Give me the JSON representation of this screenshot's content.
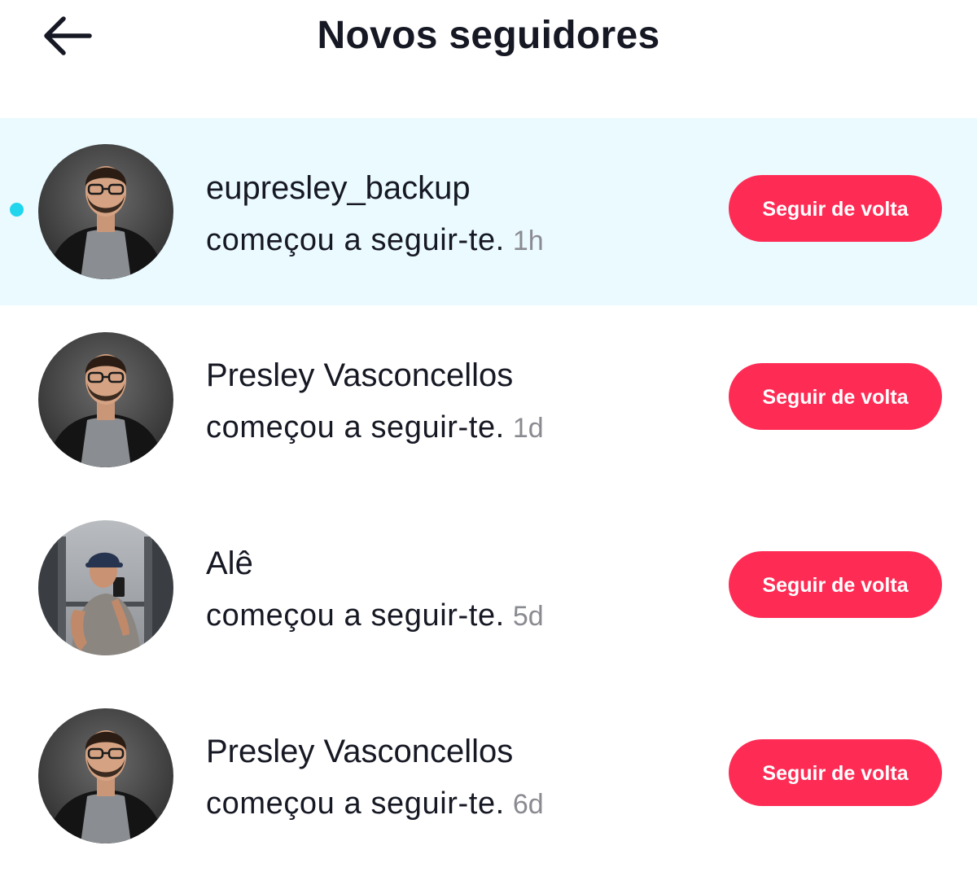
{
  "header": {
    "back_icon": "arrow-left-icon",
    "title": "Novos seguidores"
  },
  "colors": {
    "accent": "#fe2c55",
    "unread_background": "#eafaff",
    "unread_dot": "#20d5ec",
    "timestamp": "#8a8b91"
  },
  "followers": [
    {
      "name": "eupresley_backup",
      "action": "começou a seguir-te.",
      "time": "1h",
      "button": "Seguir de volta",
      "unread": true,
      "avatar": "profile-photo-man-glasses-beard"
    },
    {
      "name": "Presley Vasconcellos",
      "action": "começou a seguir-te.",
      "time": "1d",
      "button": "Seguir de volta",
      "unread": false,
      "avatar": "profile-photo-man-glasses-beard"
    },
    {
      "name": "Alê",
      "action": "começou a seguir-te.",
      "time": "5d",
      "button": "Seguir de volta",
      "unread": false,
      "avatar": "profile-photo-gym-mirror-selfie"
    },
    {
      "name": "Presley Vasconcellos",
      "action": "começou a seguir-te.",
      "time": "6d",
      "button": "Seguir de volta",
      "unread": false,
      "avatar": "profile-photo-man-glasses-beard"
    }
  ]
}
